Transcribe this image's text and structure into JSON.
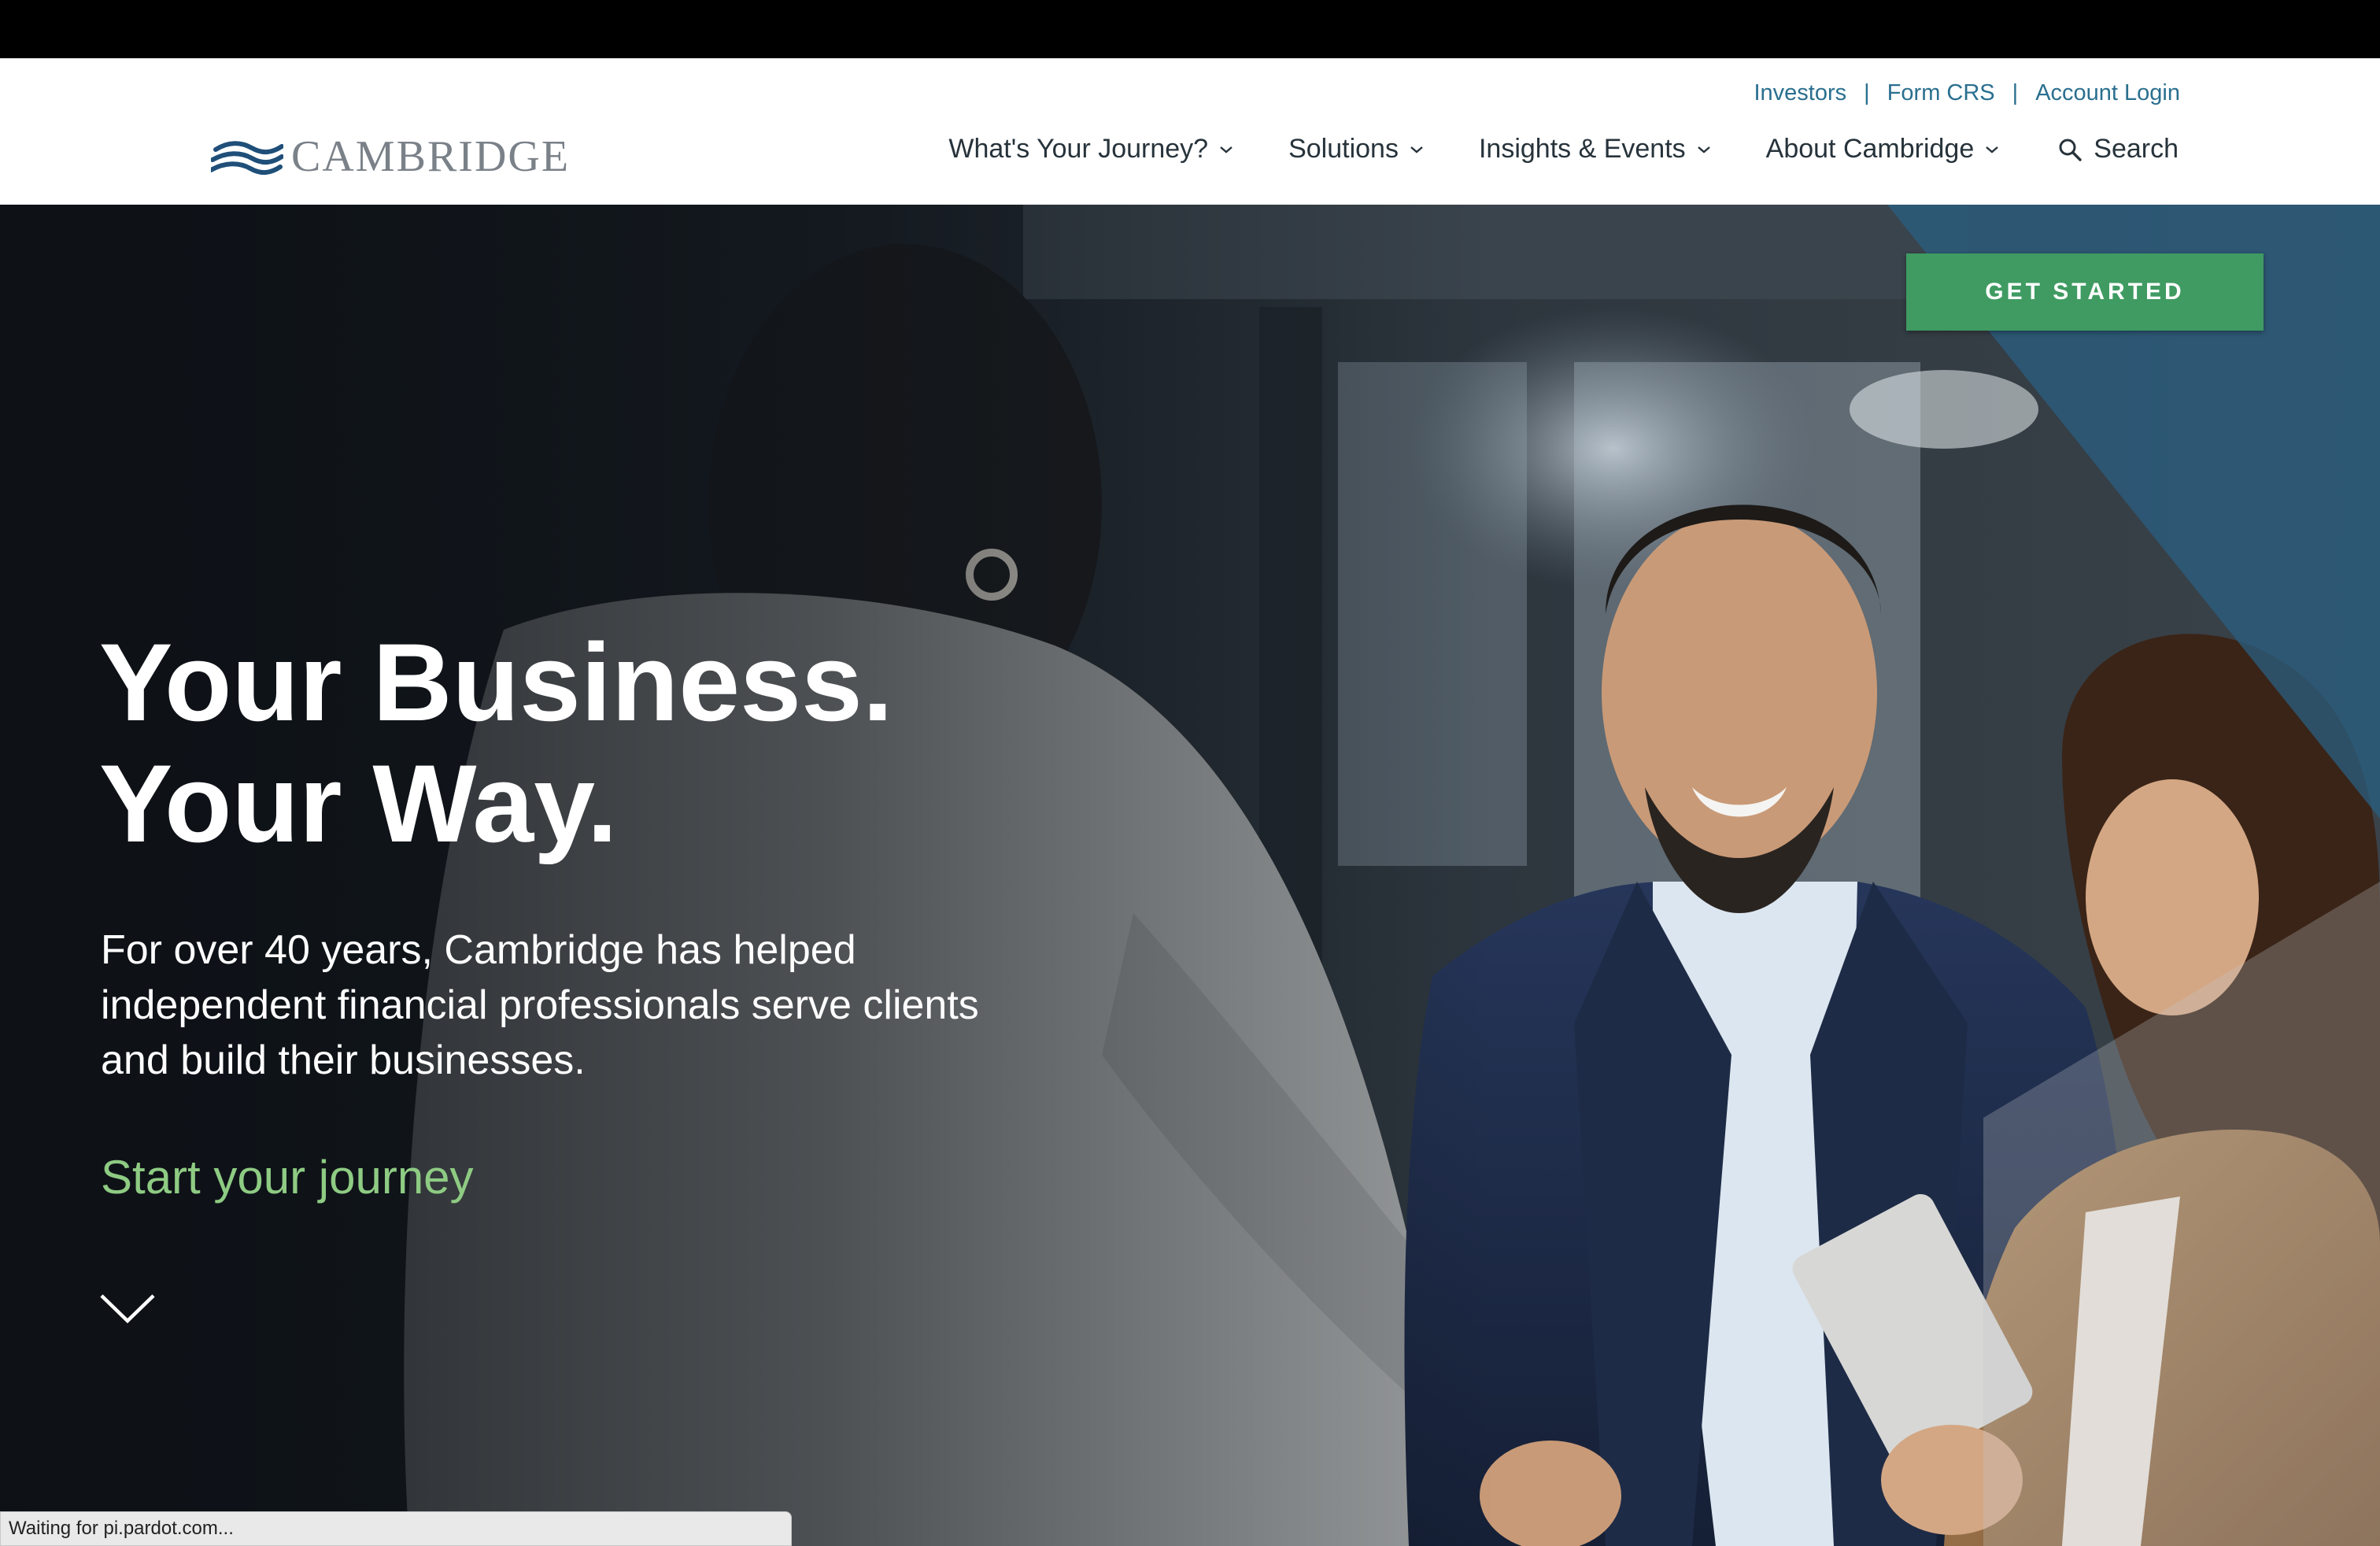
{
  "header": {
    "logo_text": "CAMBRIDGE",
    "utility_links": [
      "Investors",
      "Form CRS",
      "Account Login"
    ],
    "nav": [
      "What's Your Journey?",
      "Solutions",
      "Insights & Events",
      "About Cambridge"
    ],
    "search_label": "Search"
  },
  "hero": {
    "cta_label": "GET STARTED",
    "headline_line1": "Your Business.",
    "headline_line2": "Your Way.",
    "subtext": "For over 40 years, Cambridge has helped independent financial professionals serve clients and build their businesses.",
    "journey_link": "Start your journey"
  },
  "status_bar": {
    "text": "Waiting for pi.pardot.com..."
  },
  "colors": {
    "brand_blue": "#2a6f8f",
    "cta_green": "#3f9b62",
    "journey_green": "#8ecb83",
    "nav_text": "#27333b"
  },
  "icons": [
    "cambridge-wave-logo-icon",
    "chevron-down-icon",
    "search-icon",
    "scroll-down-chevron-icon"
  ]
}
